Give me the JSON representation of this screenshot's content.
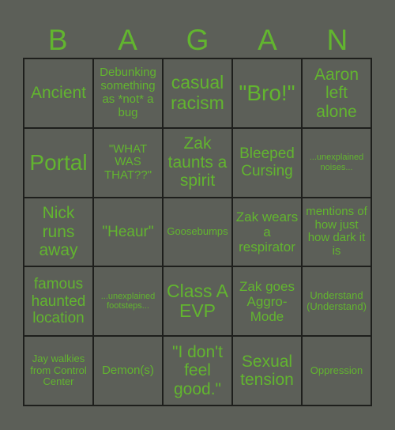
{
  "accent": "#62b52f",
  "header": [
    "B",
    "A",
    "G",
    "A",
    "N"
  ],
  "cells": [
    {
      "text": "Ancient",
      "size": "s21"
    },
    {
      "text": "Debunking something as *not* a bug",
      "size": "s15"
    },
    {
      "text": "casual racism",
      "size": "s23"
    },
    {
      "text": "\"Bro!\"",
      "size": "s28"
    },
    {
      "text": "Aaron left alone",
      "size": "s21"
    },
    {
      "text": "Portal",
      "size": "s28"
    },
    {
      "text": "\"WHAT WAS THAT??\"",
      "size": "s15"
    },
    {
      "text": "Zak taunts a spirit",
      "size": "s21"
    },
    {
      "text": "Bleeped Cursing",
      "size": "s19"
    },
    {
      "text": "...unexplained noises...",
      "size": "s11"
    },
    {
      "text": "Nick runs away",
      "size": "s21"
    },
    {
      "text": "\"Heaur\"",
      "size": "s19"
    },
    {
      "text": "Goosebumps",
      "size": "s13"
    },
    {
      "text": "Zak wears a respirator",
      "size": "s17"
    },
    {
      "text": "mentions of how just how dark it is",
      "size": "s15"
    },
    {
      "text": "famous haunted location",
      "size": "s19"
    },
    {
      "text": "...unexplained footsteps...",
      "size": "s11"
    },
    {
      "text": "Class A EVP",
      "size": "s23"
    },
    {
      "text": "Zak goes Aggro-Mode",
      "size": "s17"
    },
    {
      "text": "Understand (Understand)",
      "size": "s13"
    },
    {
      "text": "Jay walkies from Control Center",
      "size": "s13"
    },
    {
      "text": "Demon(s)",
      "size": "s15"
    },
    {
      "text": "\"I don't feel good.\"",
      "size": "s21"
    },
    {
      "text": "Sexual tension",
      "size": "s21"
    },
    {
      "text": "Oppression",
      "size": "s13"
    }
  ]
}
